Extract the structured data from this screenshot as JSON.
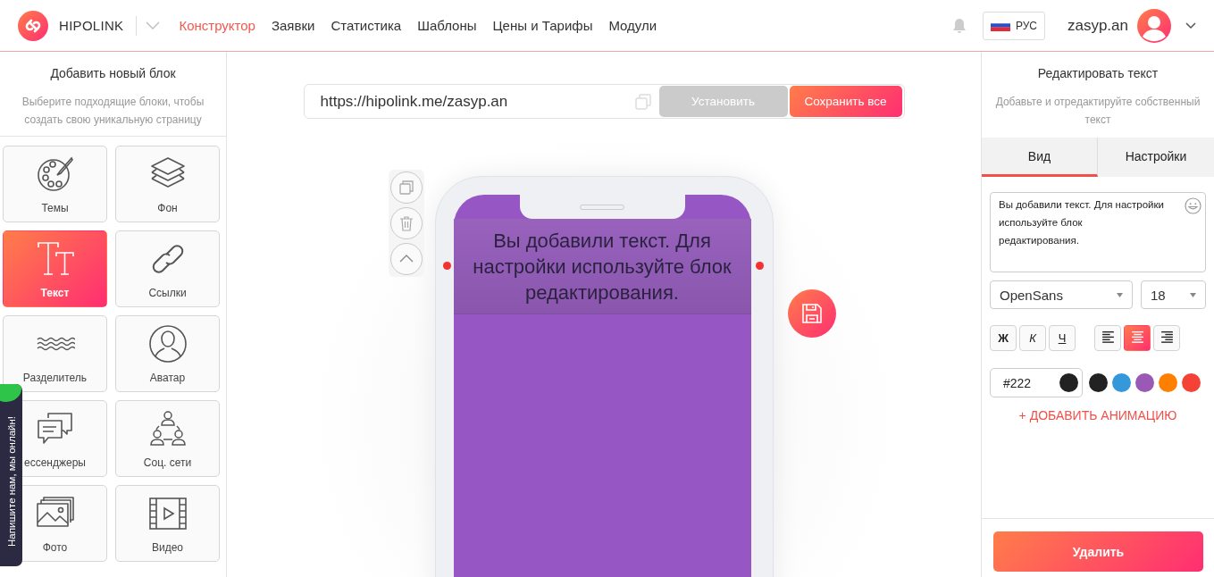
{
  "header": {
    "logo_text": "HIPOLINK",
    "nav": [
      {
        "label": "Конструктор",
        "selected": true
      },
      {
        "label": "Заявки",
        "selected": false
      },
      {
        "label": "Статистика",
        "selected": false
      },
      {
        "label": "Шаблоны",
        "selected": false
      },
      {
        "label": "Цены и Тарифы",
        "selected": false
      },
      {
        "label": "Модули",
        "selected": false
      }
    ],
    "language": "РУС",
    "username": "zasyp.an"
  },
  "left_panel": {
    "title": "Добавить новый блок",
    "subtitle": "Выберите подходящие блоки, чтобы создать свою уникальную страницу",
    "blocks": [
      {
        "label": "Темы",
        "kind": "palette",
        "selected": false
      },
      {
        "label": "Фон",
        "kind": "layers",
        "selected": false
      },
      {
        "label": "Текст",
        "kind": "text",
        "selected": true
      },
      {
        "label": "Ссылки",
        "kind": "link",
        "selected": false
      },
      {
        "label": "Разделитель",
        "kind": "divider",
        "selected": false
      },
      {
        "label": "Аватар",
        "kind": "avatar",
        "selected": false
      },
      {
        "label": "ессенджеры",
        "kind": "chat",
        "selected": false
      },
      {
        "label": "Соц. сети",
        "kind": "people",
        "selected": false
      },
      {
        "label": "Фото",
        "kind": "photo",
        "selected": false
      },
      {
        "label": "Видео",
        "kind": "video",
        "selected": false
      }
    ]
  },
  "chat_tab": {
    "text": "Напишите нам, мы онлайн!"
  },
  "editor": {
    "url": "https://hipolink.me/zasyp.an",
    "buttons": [
      {
        "label": "Установить",
        "disabled": true
      },
      {
        "label": "Сохранить все",
        "disabled": false
      }
    ],
    "phone_text": "Вы добавили текст. Для настройки используйте блок редактирования."
  },
  "right_panel": {
    "title": "Редактировать текст",
    "subtitle": "Добавьте и отредактируйте собственный текст",
    "tabs": [
      {
        "label": "Вид",
        "selected": true
      },
      {
        "label": "Настройки",
        "selected": false
      }
    ],
    "text_value": "Вы добавили текст. Для настройки используйте блок\nредактирования.",
    "font": "OpenSans",
    "size": "18",
    "format_buttons": [
      {
        "label": "Ж",
        "kind": "bold",
        "selected": false
      },
      {
        "label": "К",
        "kind": "italic",
        "selected": false
      },
      {
        "label": "Ч",
        "kind": "underline",
        "selected": false
      }
    ],
    "alignment": [
      {
        "kind": "left",
        "selected": false
      },
      {
        "kind": "center",
        "selected": true
      },
      {
        "kind": "right",
        "selected": false
      }
    ],
    "color_field": {
      "value": "#222",
      "color": "#222222"
    },
    "swatches": [
      {
        "color": "#222222"
      },
      {
        "color": "#3498db"
      },
      {
        "color": "#9b59b6"
      },
      {
        "color": "#ff7f00"
      },
      {
        "color": "#f44336"
      }
    ],
    "animation_link": "+ ДОБАВИТЬ АНИМАЦИЮ",
    "delete_button": "Удалить"
  }
}
